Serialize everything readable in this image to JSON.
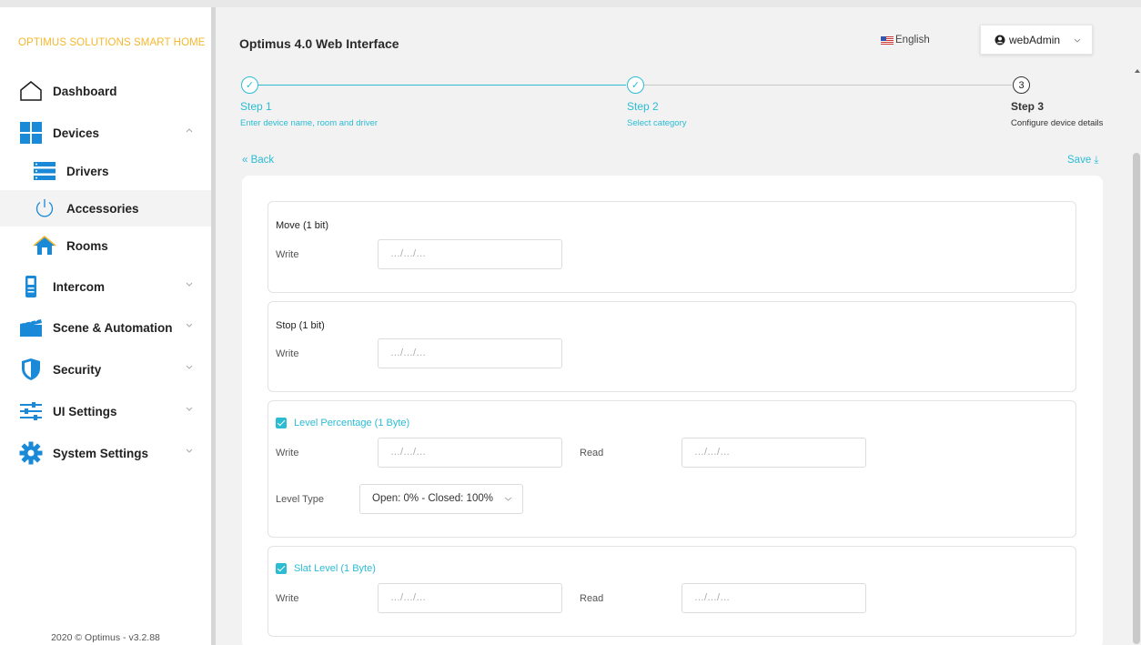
{
  "app": {
    "brand": "OPTIMUS SOLUTIONS SMART HOME",
    "title": "Optimus 4.0 Web Interface",
    "language": "English",
    "user": "webAdmin",
    "footer": "2020 © Optimus - v3.2.88"
  },
  "sidebar": {
    "items": [
      {
        "label": "Dashboard",
        "icon": "house-icon"
      },
      {
        "label": "Devices",
        "icon": "grid-icon",
        "expanded": true
      },
      {
        "label": "Drivers",
        "icon": "server-icon"
      },
      {
        "label": "Accessories",
        "icon": "power-icon",
        "active": true
      },
      {
        "label": "Rooms",
        "icon": "home-icon"
      },
      {
        "label": "Intercom",
        "icon": "intercom-icon"
      },
      {
        "label": "Scene & Automation",
        "icon": "clapper-icon"
      },
      {
        "label": "Security",
        "icon": "shield-icon"
      },
      {
        "label": "UI Settings",
        "icon": "sliders-icon"
      },
      {
        "label": "System Settings",
        "icon": "gear-icon"
      }
    ]
  },
  "steps": [
    {
      "title": "Step 1",
      "desc": "Enter device name, room and driver",
      "mark": "✓",
      "state": "done"
    },
    {
      "title": "Step 2",
      "desc": "Select category",
      "mark": "✓",
      "state": "done"
    },
    {
      "title": "Step 3",
      "desc": "Configure device details",
      "mark": "3",
      "state": "current"
    }
  ],
  "actions": {
    "back": "« Back",
    "save": "Save ⤓"
  },
  "form": {
    "move": {
      "title": "Move (1 bit)",
      "write_label": "Write",
      "write_placeholder": "…/…/…"
    },
    "stop": {
      "title": "Stop (1 bit)",
      "write_label": "Write",
      "write_placeholder": "…/…/…"
    },
    "level": {
      "title": "Level Percentage (1 Byte)",
      "checked": true,
      "write_label": "Write",
      "write_placeholder": "…/…/…",
      "read_label": "Read",
      "read_placeholder": "…/…/…",
      "type_label": "Level Type",
      "type_value": "Open: 0% - Closed: 100%"
    },
    "slat": {
      "title": "Slat Level (1 Byte)",
      "checked": true,
      "write_label": "Write",
      "write_placeholder": "…/…/…",
      "read_label": "Read",
      "read_placeholder": "…/…/…"
    }
  },
  "colors": {
    "accent": "#2bbcd4",
    "brand": "#f5b82e",
    "icon_blue": "#1a8ad8"
  }
}
